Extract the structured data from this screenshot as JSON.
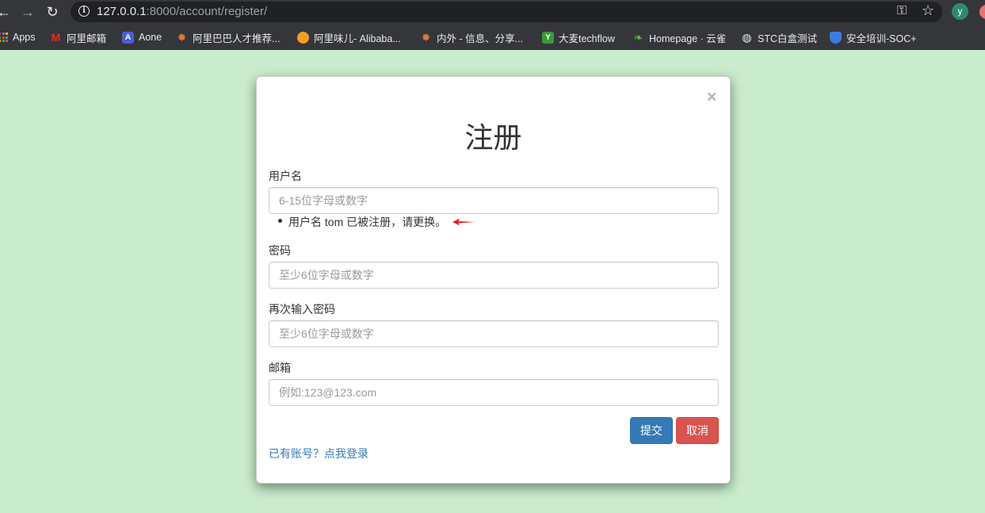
{
  "browser": {
    "url_host": "127.0.0.1",
    "url_path": ":8000/account/register/",
    "profile_initial": "y"
  },
  "bookmarks": [
    {
      "label": "Apps",
      "icon": "apps-grid-icon"
    },
    {
      "label": "阿里邮箱",
      "icon": "mail-icon",
      "color": "#d93025"
    },
    {
      "label": "Aone",
      "icon": "aone-icon",
      "color": "#4a5fd1"
    },
    {
      "label": "阿里巴巴人才推荐...",
      "icon": "alibaba-talent-icon",
      "color": "#e8743b"
    },
    {
      "label": "阿里味儿- Alibaba...",
      "icon": "alibaba-flavor-icon",
      "color": "#f0a020"
    },
    {
      "label": "内外 - 信息、分享...",
      "icon": "neiwai-icon",
      "color": "#e8743b"
    },
    {
      "label": "大麦techflow",
      "icon": "damai-icon",
      "color": "#3a9a3a"
    },
    {
      "label": "Homepage · 云雀",
      "icon": "yunque-icon",
      "color": "#5cbf3a"
    },
    {
      "label": "STC白盒测试",
      "icon": "globe-icon",
      "color": "#e8eaed"
    },
    {
      "label": "安全培训-SOC+",
      "icon": "shield-icon",
      "color": "#3b7ddd"
    }
  ],
  "modal": {
    "close_label": "×",
    "title": "注册",
    "fields": {
      "username": {
        "label": "用户名",
        "placeholder": "6-15位字母或数字",
        "value": ""
      },
      "password": {
        "label": "密码",
        "placeholder": "至少6位字母或数字",
        "value": ""
      },
      "password_confirm": {
        "label": "再次输入密码",
        "placeholder": "至少6位字母或数字",
        "value": ""
      },
      "email": {
        "label": "邮箱",
        "placeholder": "例如:123@123.com",
        "value": ""
      }
    },
    "error_message": "用户名 tom 已被注册，请更换。",
    "submit_label": "提交",
    "cancel_label": "取消",
    "login_link": "已有账号？点我登录"
  },
  "colors": {
    "page_background": "#c9edcc",
    "primary": "#337ab7",
    "danger": "#d9534f",
    "annotation_arrow": "#e02020"
  }
}
